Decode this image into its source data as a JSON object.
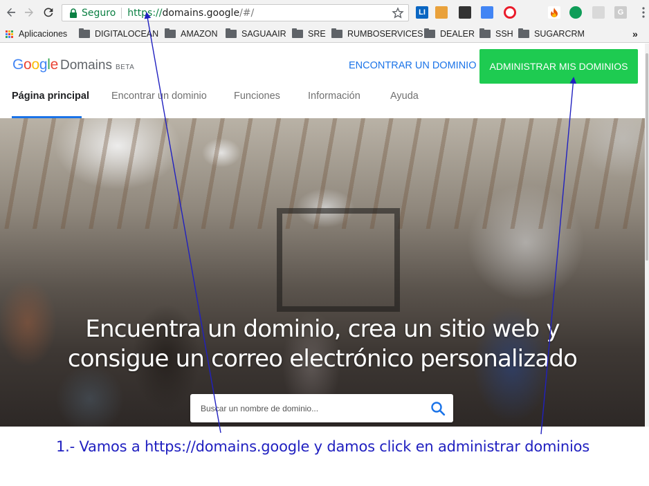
{
  "browser": {
    "secure_label": "Seguro",
    "url_scheme": "https://",
    "url_host": "domains.google",
    "url_path": "/#/",
    "extensions": [
      {
        "name": "linkedin-extension-icon",
        "text": "LI",
        "bg": "#0a66c2",
        "color": "#ffffff"
      },
      {
        "name": "colorful-bars-extension-icon",
        "text": "",
        "bg": "#e9a13b",
        "color": "#ffffff"
      },
      {
        "name": "film-extension-icon",
        "text": "",
        "bg": "#333333",
        "color": "#ffffff"
      },
      {
        "name": "google-translate-icon",
        "text": "",
        "bg": "#4285f4",
        "color": "#ffffff"
      },
      {
        "name": "opera-extension-icon",
        "text": "",
        "bg": "#ffffff",
        "color": "#ea1b2a"
      },
      {
        "name": "fire-extension-icon",
        "text": "",
        "bg": "#ffffff",
        "color": "#e8580c"
      },
      {
        "name": "hangouts-icon",
        "text": "",
        "bg": "#0f9d58",
        "color": "#ffffff"
      },
      {
        "name": "grey-tab-extension-icon",
        "text": "",
        "bg": "#d9d9d9",
        "color": "#ffffff"
      },
      {
        "name": "g-extension-icon",
        "text": "G",
        "bg": "#cccccc",
        "color": "#ffffff"
      }
    ]
  },
  "bookmarks": {
    "apps_label": "Aplicaciones",
    "items": [
      "DIGITALOCEAN",
      "AMAZON",
      "SAGUAAIR",
      "SRE",
      "RUMBOSERVICES",
      "DEALER",
      "SSH",
      "SUGARCRM"
    ],
    "overflow": "»"
  },
  "header": {
    "logo_google": [
      "G",
      "o",
      "o",
      "g",
      "l",
      "e"
    ],
    "logo_colors": [
      "#4285f4",
      "#ea4335",
      "#fbbc05",
      "#4285f4",
      "#34a853",
      "#ea4335"
    ],
    "logo_product": "Domains",
    "logo_beta": "BETA",
    "find_domain_link": "ENCONTRAR UN DOMINIO",
    "admin_button": "ADMINISTRAR MIS DOMINIOS",
    "nav": [
      "Página principal",
      "Encontrar un dominio",
      "Funciones",
      "Información",
      "Ayuda"
    ]
  },
  "hero": {
    "title_line1": "Encuentra un dominio, crea un sitio web y",
    "title_line2": "consigue un correo electrónico personalizado",
    "search_placeholder": "Buscar un nombre de dominio..."
  },
  "annotation": {
    "caption": "1.- Vamos a https://domains.google y damos click en administrar dominios",
    "color": "#2020c0"
  },
  "colors": {
    "accent_blue": "#1a73e8",
    "admin_green": "#1ecb51",
    "secure_green": "#0b8043"
  }
}
